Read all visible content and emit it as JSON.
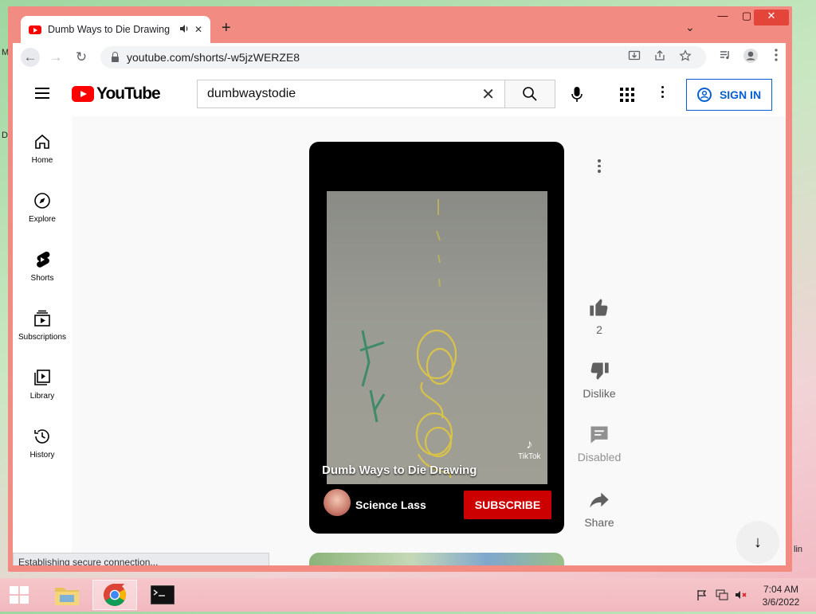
{
  "desktop": {
    "left_letters": [
      "M",
      "D"
    ],
    "right_letters": "lin"
  },
  "browser": {
    "tab": {
      "title": "Dumb Ways to Die Drawing",
      "audio_icon": "speaker-icon",
      "close_glyph": "✕"
    },
    "new_tab_glyph": "+",
    "tab_search_glyph": "⌄",
    "window_controls": {
      "minimize": "—",
      "maximize": "▢",
      "close": "✕"
    },
    "toolbar": {
      "back_glyph": "←",
      "forward_glyph": "→",
      "reload_glyph": "↻",
      "url": "youtube.com/shorts/-w5jzWERZE8"
    }
  },
  "youtube": {
    "logo_text": "YouTube",
    "search": {
      "value": "dumbwaystodie",
      "clear_glyph": "✕"
    },
    "sign_in_label": "SIGN IN",
    "sidebar": [
      {
        "label": "Home",
        "icon": "home-icon"
      },
      {
        "label": "Explore",
        "icon": "compass-icon"
      },
      {
        "label": "Shorts",
        "icon": "shorts-icon"
      },
      {
        "label": "Subscriptions",
        "icon": "subscriptions-icon"
      },
      {
        "label": "Library",
        "icon": "library-icon"
      },
      {
        "label": "History",
        "icon": "history-icon"
      }
    ],
    "short": {
      "title": "Dumb Ways to Die Drawing",
      "watermark": "TikTok",
      "channel_name": "Science Lass",
      "subscribe_label": "SUBSCRIBE"
    },
    "actions": {
      "like_count": "2",
      "dislike_label": "Dislike",
      "comments_label": "Disabled",
      "share_label": "Share"
    },
    "scroll_down_glyph": "↓",
    "status_text": "Establishing secure connection..."
  },
  "taskbar": {
    "time": "7:04 AM",
    "date": "3/6/2022"
  }
}
